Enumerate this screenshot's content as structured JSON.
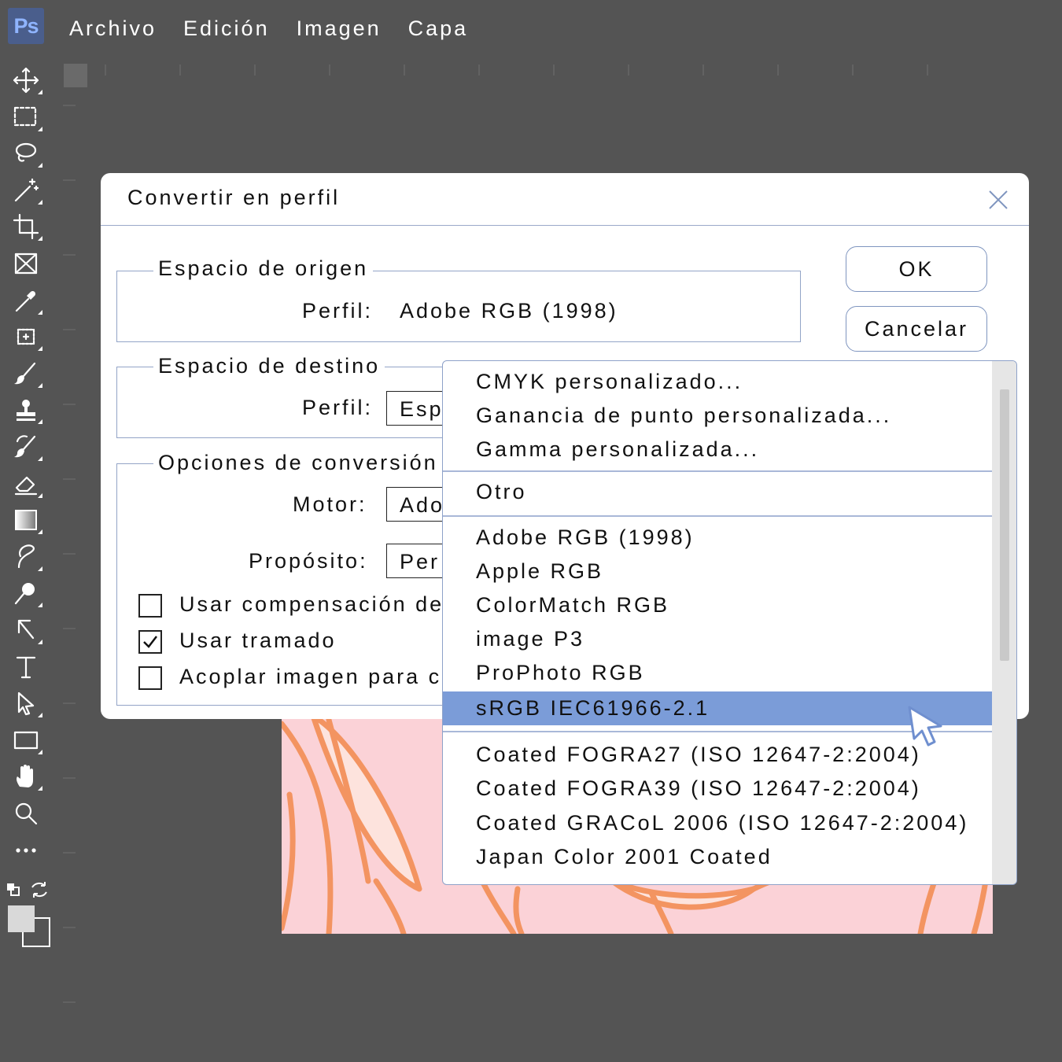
{
  "app": {
    "logo_text": "Ps"
  },
  "menubar": {
    "items": [
      "Archivo",
      "Edición",
      "Imagen",
      "Capa"
    ]
  },
  "tools": [
    "move-icon",
    "marquee-icon",
    "lasso-icon",
    "magic-wand-icon",
    "crop-icon",
    "frame-icon",
    "eyedropper-icon",
    "healing-icon",
    "brush-icon",
    "stamp-icon",
    "history-brush-icon",
    "eraser-icon",
    "gradient-icon",
    "smudge-icon",
    "dodge-icon",
    "pen-icon",
    "type-icon",
    "path-selection-icon",
    "rectangle-icon",
    "hand-icon",
    "zoom-icon",
    "more-icon"
  ],
  "dialog": {
    "title": "Convertir en perfil",
    "ok_label": "OK",
    "cancel_label": "Cancelar",
    "source": {
      "legend": "Espacio de origen",
      "profile_label": "Perfil:",
      "profile_value": "Adobe RGB (1998)"
    },
    "destination": {
      "legend": "Espacio de destino",
      "profile_label": "Perfil:",
      "profile_value": "Esp"
    },
    "options": {
      "legend": "Opciones de conversión",
      "engine_label": "Motor:",
      "engine_value": "Ado",
      "intent_label": "Propósito:",
      "intent_value": "Per",
      "checkboxes": [
        {
          "label": "Usar compensación de",
          "checked": false
        },
        {
          "label": "Usar tramado",
          "checked": true
        },
        {
          "label": "Acoplar imagen para c",
          "checked": false
        }
      ]
    }
  },
  "dropdown": {
    "group1": [
      "CMYK personalizado...",
      "Ganancia de punto personalizada...",
      "Gamma personalizada..."
    ],
    "group2": [
      "Otro"
    ],
    "group3": [
      "Adobe RGB (1998)",
      "Apple RGB",
      "ColorMatch RGB",
      "image P3",
      "ProPhoto RGB",
      "sRGB IEC61966-2.1"
    ],
    "group4": [
      "Coated FOGRA27 (ISO 12647-2:2004)",
      "Coated FOGRA39 (ISO 12647-2:2004)",
      "Coated GRACoL 2006 (ISO 12647-2:2004)",
      "Japan Color 2001 Coated"
    ],
    "selected": "sRGB IEC61966-2.1"
  },
  "colors": {
    "accent_selected": "#7b9cd8",
    "canvas_bg": "#fbd2d7",
    "leaf_stroke": "#f39461",
    "workspace": "#545454"
  }
}
